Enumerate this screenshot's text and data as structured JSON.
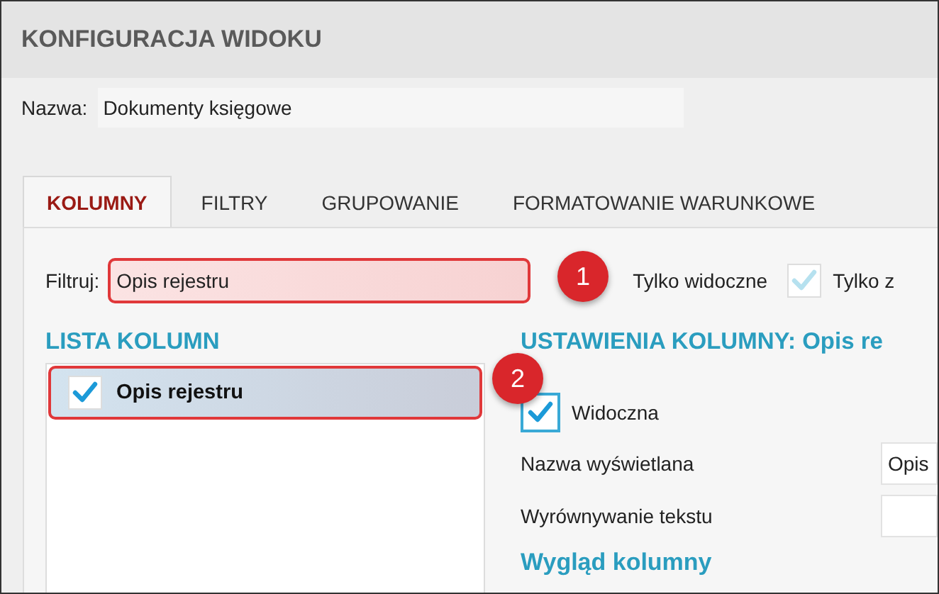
{
  "window": {
    "title": "KONFIGURACJA WIDOKU"
  },
  "name_field": {
    "label": "Nazwa:",
    "value": "Dokumenty księgowe"
  },
  "tabs": [
    {
      "label": "KOLUMNY",
      "selected": true
    },
    {
      "label": "FILTRY",
      "selected": false
    },
    {
      "label": "GRUPOWANIE",
      "selected": false
    },
    {
      "label": "FORMATOWANIE WARUNKOWE",
      "selected": false
    }
  ],
  "filter": {
    "label": "Filtruj:",
    "value": "Opis rejestru",
    "callout": "1",
    "options": [
      {
        "label": "Tylko widoczne",
        "kind": "covered"
      },
      {
        "label": "Tylko z",
        "kind": "checkbox",
        "checked": true,
        "disabled": true
      }
    ]
  },
  "column_list": {
    "title": "LISTA KOLUMN",
    "callout": "2",
    "items": [
      {
        "label": "Opis rejestru",
        "checked": true,
        "selected": true
      }
    ]
  },
  "column_settings": {
    "title": "USTAWIENIA KOLUMNY: Opis re",
    "visible": {
      "label": "Widoczna",
      "checked": true
    },
    "fields": [
      {
        "label": "Nazwa wyświetlana",
        "value": "Opis"
      },
      {
        "label": "Wyrównywanie tekstu"
      }
    ],
    "section": "Wygląd kolumny"
  }
}
